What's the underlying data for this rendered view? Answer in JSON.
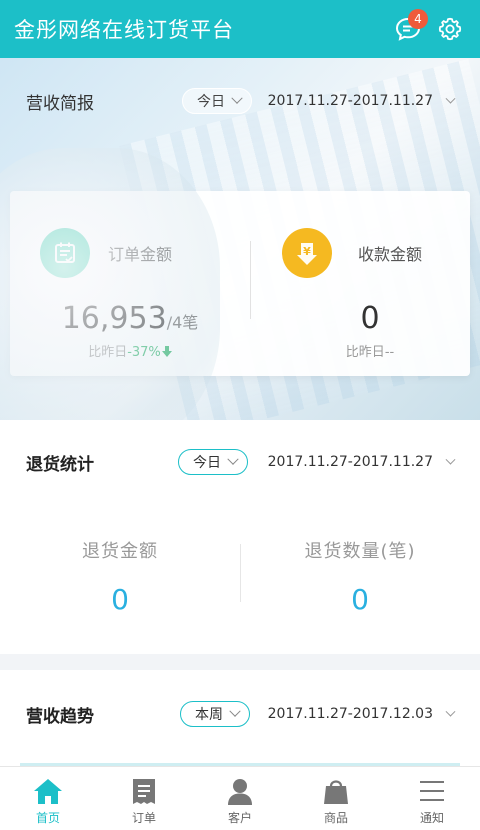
{
  "header": {
    "title": "金彤网络在线订货平台",
    "message_badge": "4",
    "icons": [
      "message-icon",
      "settings-gear-icon"
    ]
  },
  "revenue_brief": {
    "title": "营收简报",
    "period": "今日",
    "date_range": "2017.11.27-2017.11.27",
    "order_amount": {
      "label": "订单金额",
      "value": "16,953",
      "unit": "/4笔",
      "compare_prefix": "比昨日",
      "compare_value": "-37%",
      "icon": "order-list-icon",
      "color": "#3ccfb0"
    },
    "collection_amount": {
      "label": "收款金额",
      "value": "0",
      "compare_prefix": "比昨日",
      "compare_value": "--",
      "icon": "yen-icon",
      "color": "#f5b921"
    }
  },
  "return_stats": {
    "title": "退货统计",
    "period": "今日",
    "date_range": "2017.11.27-2017.11.27",
    "amount_label": "退货金额",
    "amount_value": "0",
    "count_label": "退货数量(笔)",
    "count_value": "0"
  },
  "revenue_trend": {
    "title": "营收趋势",
    "period": "本周",
    "date_range": "2017.11.27-2017.12.03"
  },
  "tabbar": {
    "items": [
      {
        "label": "首页",
        "icon": "home-icon",
        "active": true
      },
      {
        "label": "订单",
        "icon": "order-icon",
        "active": false
      },
      {
        "label": "客户",
        "icon": "customer-icon",
        "active": false
      },
      {
        "label": "商品",
        "icon": "product-bag-icon",
        "active": false
      },
      {
        "label": "通知",
        "icon": "notice-icon",
        "active": false
      }
    ]
  },
  "colors": {
    "brand": "#1cbfc8",
    "value_blue": "#2ab0e0",
    "decrease_green": "#2db36b",
    "badge_red": "#ef5b3b"
  }
}
